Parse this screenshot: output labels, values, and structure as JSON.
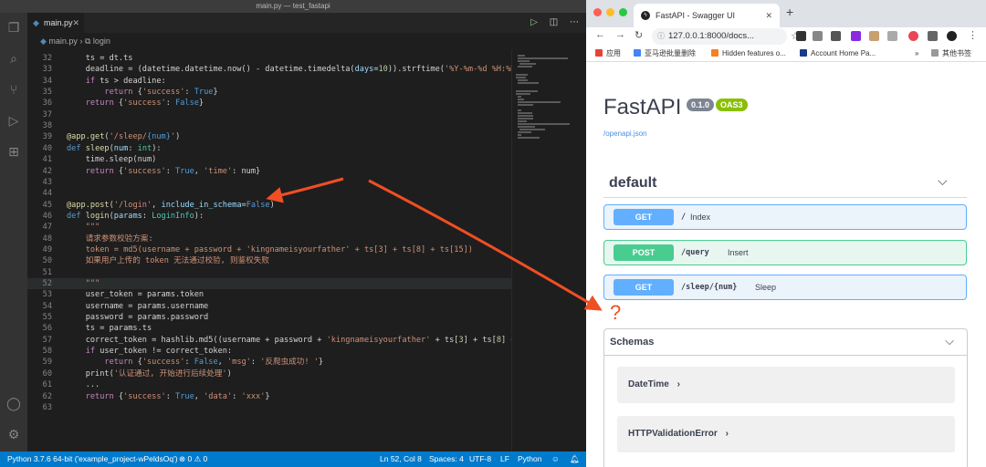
{
  "vscode": {
    "window_title": "main.py — test_fastapi",
    "tab_label": "main.py",
    "breadcrumb": {
      "file": "main.py",
      "symbol": "login"
    },
    "code_lines": [
      {
        "n": "32",
        "html": "    ts = dt.ts"
      },
      {
        "n": "33",
        "html": "    deadline = (datetime.datetime.now() - datetime.timedelta(<span class='pa'>days</span>=<span class='nm'>10</span>)).strftime(<span class='st'>'%Y-%m-%d %H:%M:%S'</span>)"
      },
      {
        "n": "34",
        "html": "    <span class='kw'>if</span> ts &gt; deadline:"
      },
      {
        "n": "35",
        "html": "        <span class='kw'>return</span> {<span class='st'>'success'</span>: <span class='bl'>True</span>}"
      },
      {
        "n": "36",
        "html": "    <span class='kw'>return</span> {<span class='st'>'success'</span>: <span class='bl'>False</span>}"
      },
      {
        "n": "37",
        "html": ""
      },
      {
        "n": "38",
        "html": ""
      },
      {
        "n": "39",
        "html": "<span class='fn'>@app.get</span>(<span class='st'>'/sleep/</span><span class='bl'>{num}</span><span class='st'>'</span>)"
      },
      {
        "n": "40",
        "html": "<span class='bl'>def</span> <span class='fn'>sleep</span>(<span class='pa'>num</span>: <span class='ty'>int</span>):"
      },
      {
        "n": "41",
        "html": "    time.sleep(num)"
      },
      {
        "n": "42",
        "html": "    <span class='kw'>return</span> {<span class='st'>'success'</span>: <span class='bl'>True</span>, <span class='st'>'time'</span>: num}"
      },
      {
        "n": "43",
        "html": ""
      },
      {
        "n": "44",
        "html": ""
      },
      {
        "n": "45",
        "html": "<span class='fn'>@app.post</span>(<span class='st'>'/login'</span>, <span class='pa'>include_in_schema</span>=<span class='bl'>False</span>)"
      },
      {
        "n": "46",
        "html": "<span class='bl'>def</span> <span class='fn'>login</span>(<span class='pa'>params</span>: <span class='ty'>LoginInfo</span>):"
      },
      {
        "n": "47",
        "html": "    <span class='dc'>\"\"\"</span>"
      },
      {
        "n": "48",
        "html": "    <span class='dc'>请求参数校验方案:</span>"
      },
      {
        "n": "49",
        "html": "    <span class='dc'>token = md5(username + password + 'kingnameisyourfather' + ts[3] + ts[8] + ts[15])</span>"
      },
      {
        "n": "50",
        "html": "    <span class='dc'>如果用户上传的 token 无法通过校验, 则鉴权失败</span>"
      },
      {
        "n": "51",
        "html": ""
      },
      {
        "n": "52",
        "html": "    <span class='dc'>\"\"\"</span>",
        "current": true
      },
      {
        "n": "53",
        "html": "    user_token = params.token"
      },
      {
        "n": "54",
        "html": "    username = params.username"
      },
      {
        "n": "55",
        "html": "    password = params.password"
      },
      {
        "n": "56",
        "html": "    ts = params.ts"
      },
      {
        "n": "57",
        "html": "    correct_token = hashlib.md5((username + password + <span class='st'>'kingnameisyourfather'</span> + ts[<span class='nm'>3</span>] + ts[<span class='nm'>8</span>] + ts[<span class='nm'>15</span>])"
      },
      {
        "n": "58",
        "html": "    <span class='kw'>if</span> user_token != correct_token:"
      },
      {
        "n": "59",
        "html": "        <span class='kw'>return</span> {<span class='st'>'success'</span>: <span class='bl'>False</span>, <span class='st'>'msg'</span>: <span class='st'>'反爬虫成功! '</span>}"
      },
      {
        "n": "60",
        "html": "    print(<span class='st'>'认证通过, 开始进行后续处理'</span>)"
      },
      {
        "n": "61",
        "html": "    ..."
      },
      {
        "n": "62",
        "html": "    <span class='kw'>return</span> {<span class='st'>'success'</span>: <span class='bl'>True</span>, <span class='st'>'data'</span>: <span class='st'>'xxx'</span>}"
      },
      {
        "n": "63",
        "html": ""
      }
    ],
    "status": {
      "interpreter": "Python 3.7.6 64-bit ('example_project-wPeldsOq')",
      "problems": "⊗ 0 ⚠ 0",
      "position": "Ln 52, Col 8",
      "spaces": "Spaces: 4",
      "encoding": "UTF-8",
      "eol": "LF",
      "language": "Python"
    }
  },
  "browser": {
    "tab_title": "FastAPI - Swagger UI",
    "url": "127.0.0.1:8000/docs...",
    "bookmarks": [
      "应用",
      "亚马逊批量删除",
      "Hidden features o...",
      "Account Home Pa...",
      "其他书签"
    ],
    "bookmarks_more": "»",
    "swagger": {
      "title": "FastAPI",
      "version": "0.1.0",
      "oas": "OAS3",
      "openapi_link": "/openapi.json",
      "section": "default",
      "operations": [
        {
          "method": "GET",
          "path": "/",
          "desc": "Index"
        },
        {
          "method": "POST",
          "path": "/query",
          "desc": "Insert"
        },
        {
          "method": "GET",
          "path": "/sleep/{num}",
          "desc": "Sleep"
        }
      ],
      "question_mark": "?",
      "schemas_title": "Schemas",
      "models": [
        "DateTime",
        "HTTPValidationError"
      ]
    }
  },
  "colors": {
    "get": "#61affe",
    "post": "#49cc90",
    "get_bg": "#ebf3fb",
    "post_bg": "#e8f6f0",
    "arrow": "#f04e23",
    "vscode_status": "#007acc"
  }
}
